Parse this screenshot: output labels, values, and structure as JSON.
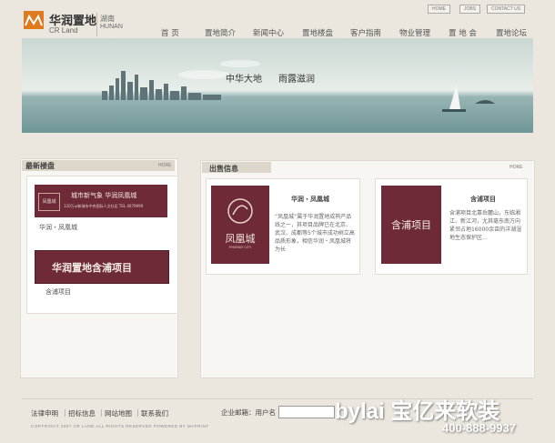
{
  "header": {
    "logo_cn": "华润置地",
    "logo_en": "CR Land",
    "region_cn": "湖南",
    "region_en": "HUNAN",
    "top_links": [
      "HOME",
      "JOBS",
      "CONTACT US"
    ],
    "nav": [
      "首 页",
      "置地简介",
      "新闻中心",
      "置地楼盘",
      "客户指南",
      "物业管理",
      "置 地 会",
      "置地论坛"
    ]
  },
  "banner": {
    "text1": "中华大地",
    "text2": "雨露滋润"
  },
  "latest": {
    "title": "最新楼盘",
    "more": "HORE",
    "ad1_line1": "城市新气象  华润凤凰城",
    "ad1_line2": "120万㎡新城市中央国际人文社区   TEL 4079999",
    "ad1_logo": "凤凰城",
    "item1": "华润・凤凰城",
    "ad2_text": "华润置地含浦项目",
    "item2": "含浦项目"
  },
  "sale": {
    "title": "出售信息",
    "more": "HORE",
    "card1_logo": "凤凰城",
    "card1_sub": "PHOENIX CITY",
    "card1_title": "华润・凤凰城",
    "card1_desc": "“凤凰城”属于华润置地成熟产品线之一，其项目品牌已在北京、武汉、成都等5个城市成功树立高品质形象，相信华润・凤凰城将为长",
    "card2_logo": "含浦项目",
    "card2_title": "含浦项目",
    "card2_desc": "含浦项目北靠岳麓山，东临湘江、新江河，尤其毫东南方向紧邻占地16000余亩的洋湖湿地生态保护区..."
  },
  "footer": {
    "links": [
      "法律申明",
      "招标信息",
      "网站地图",
      "联系我们"
    ],
    "copyright": "COPYRIGHT 2007 CR LAND   ALL RIGHTS RESERVED   POWERED BY MAPRINT",
    "email_label": "企业邮箱：用户名",
    "watermark": "bylai 宝亿来软装",
    "phone": "400-888-9937"
  },
  "colors": {
    "accent": "#e07a1f",
    "wine": "#6e2a36",
    "banner_sea": "#7da2a1"
  }
}
